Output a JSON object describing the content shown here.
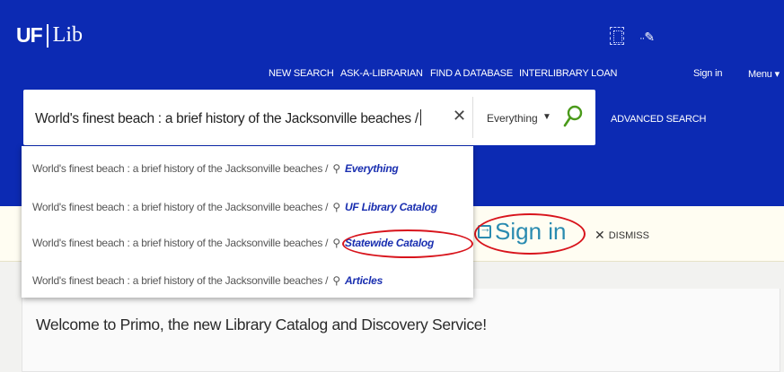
{
  "header": {
    "logo_uf": "UF",
    "logo_lib": "Lib",
    "nav": [
      {
        "label": "NEW SEARCH"
      },
      {
        "label": "ASK-A-LIBRARIAN"
      },
      {
        "label": "FIND A DATABASE"
      },
      {
        "label": "INTERLIBRARY LOAN"
      }
    ],
    "sign_in": "Sign in",
    "menu": "Menu ▾"
  },
  "search": {
    "query": "World's finest beach : a brief history of the Jacksonville beaches /",
    "scope": "Everything",
    "advanced_label": "ADVANCED SEARCH"
  },
  "suggestions": [
    {
      "text": "World's finest beach : a brief history of the Jacksonville beaches /",
      "scope": "Everything"
    },
    {
      "text": "World's finest beach : a brief history of the Jacksonville beaches /",
      "scope": "UF Library Catalog"
    },
    {
      "text": "World's finest beach : a brief history of the Jacksonville beaches /",
      "scope": "Statewide Catalog"
    },
    {
      "text": "World's finest beach : a brief history of the Jacksonville beaches /",
      "scope": "Articles"
    }
  ],
  "banner": {
    "sign_in_label": "Sign in",
    "dismiss_label": "DISMISS"
  },
  "welcome": {
    "text": "Welcome to Primo, the new Library Catalog and Discovery Service!"
  },
  "colors": {
    "header_bg": "#0c2ab3",
    "annotation_red": "#d8141c",
    "sign_in_teal": "#2a8bb0",
    "scope_link": "#1a2fb0"
  }
}
